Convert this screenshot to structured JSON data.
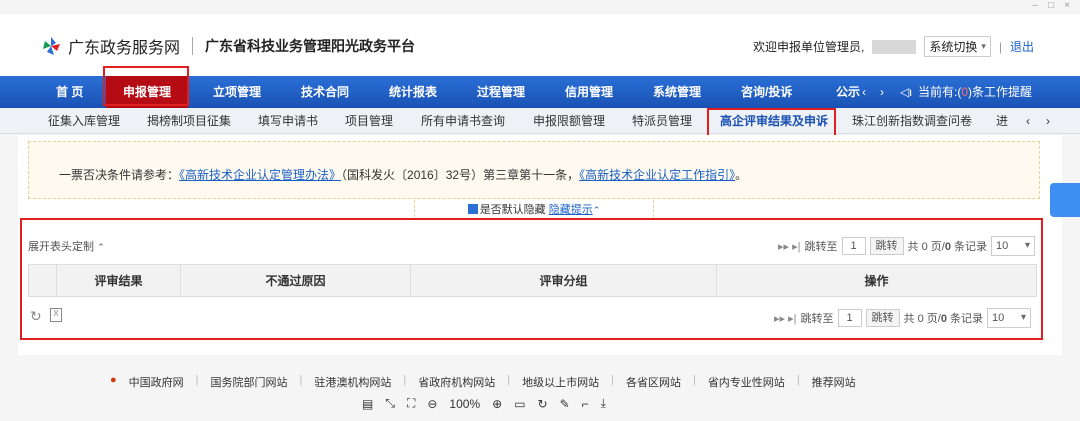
{
  "window_controls": {
    "minimize": "–",
    "maximize": "□",
    "close": "×"
  },
  "header": {
    "brand": "广东政务服务网",
    "platform": "广东省科技业务管理阳光政务平台",
    "welcome": "欢迎申报单位管理员,",
    "switch_label": "系统切换",
    "exit_label": "退出"
  },
  "nav": {
    "items": [
      "首 页",
      "申报管理",
      "立项管理",
      "技术合同",
      "统计报表",
      "过程管理",
      "信用管理",
      "系统管理",
      "咨询/投诉",
      "公示"
    ],
    "active": "申报管理",
    "notice_prefix": "当前有:",
    "notice_count": "0",
    "notice_suffix": "条工作提醒"
  },
  "subnav": {
    "items": [
      "征集入库管理",
      "揭榜制项目征集",
      "填写申请书",
      "项目管理",
      "所有申请书查询",
      "申报限额管理",
      "特派员管理",
      "高企评审结果及申诉",
      "珠江创新指数调查问卷",
      "进度"
    ],
    "active": "高企评审结果及申诉"
  },
  "notice": {
    "prefix": "一票否决条件请参考：",
    "link1": "《高新技术企业认定管理办法》",
    "middle": "（国科发火〔2016〕32号）第三章第十一条，",
    "link2": "《高新技术企业认定工作指引》",
    "suffix": "。",
    "hide_checkbox_label": "是否默认隐藏",
    "hide_link": "隐藏提示"
  },
  "table": {
    "header_custom": "展开表头定制",
    "columns": [
      "评审结果",
      "不通过原因",
      "评审分组",
      "操作"
    ],
    "rows": []
  },
  "pager": {
    "jump_to": "跳转至",
    "page_value": "1",
    "jump_button": "跳转",
    "total_prefix": "共",
    "total_pages": "0",
    "page_unit": "页/",
    "total_records": "0",
    "record_unit": "条记录",
    "page_size": "10"
  },
  "footer": {
    "links": [
      "中国政府网",
      "国务院部门网站",
      "驻港澳机构网站",
      "省政府机构网站",
      "地级以上市网站",
      "各省区网站",
      "省内专业性网站",
      "推荐网站"
    ]
  },
  "viewer": {
    "zoom": "100%"
  }
}
